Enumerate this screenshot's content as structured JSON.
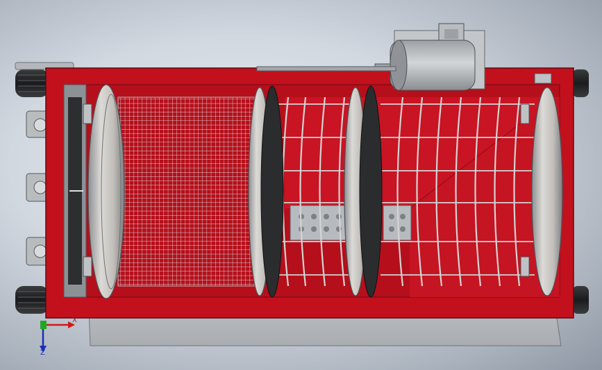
{
  "view": {
    "type": "cad-3d-assembly-top-view",
    "colors": {
      "frame_red": "#c3101d",
      "frame_red_dark": "#8e0a14",
      "steel_light": "#c7c9cb",
      "steel_mid": "#9ea3a8",
      "ring_dark": "#2a2c2e",
      "wire": "#d6d6d6",
      "background": "#d2d8e0"
    }
  },
  "triad": {
    "x_label": "X",
    "z_label": "Z",
    "x_color": "#d11818",
    "y_color": "#1fa81f",
    "z_color": "#1b2fb8"
  }
}
